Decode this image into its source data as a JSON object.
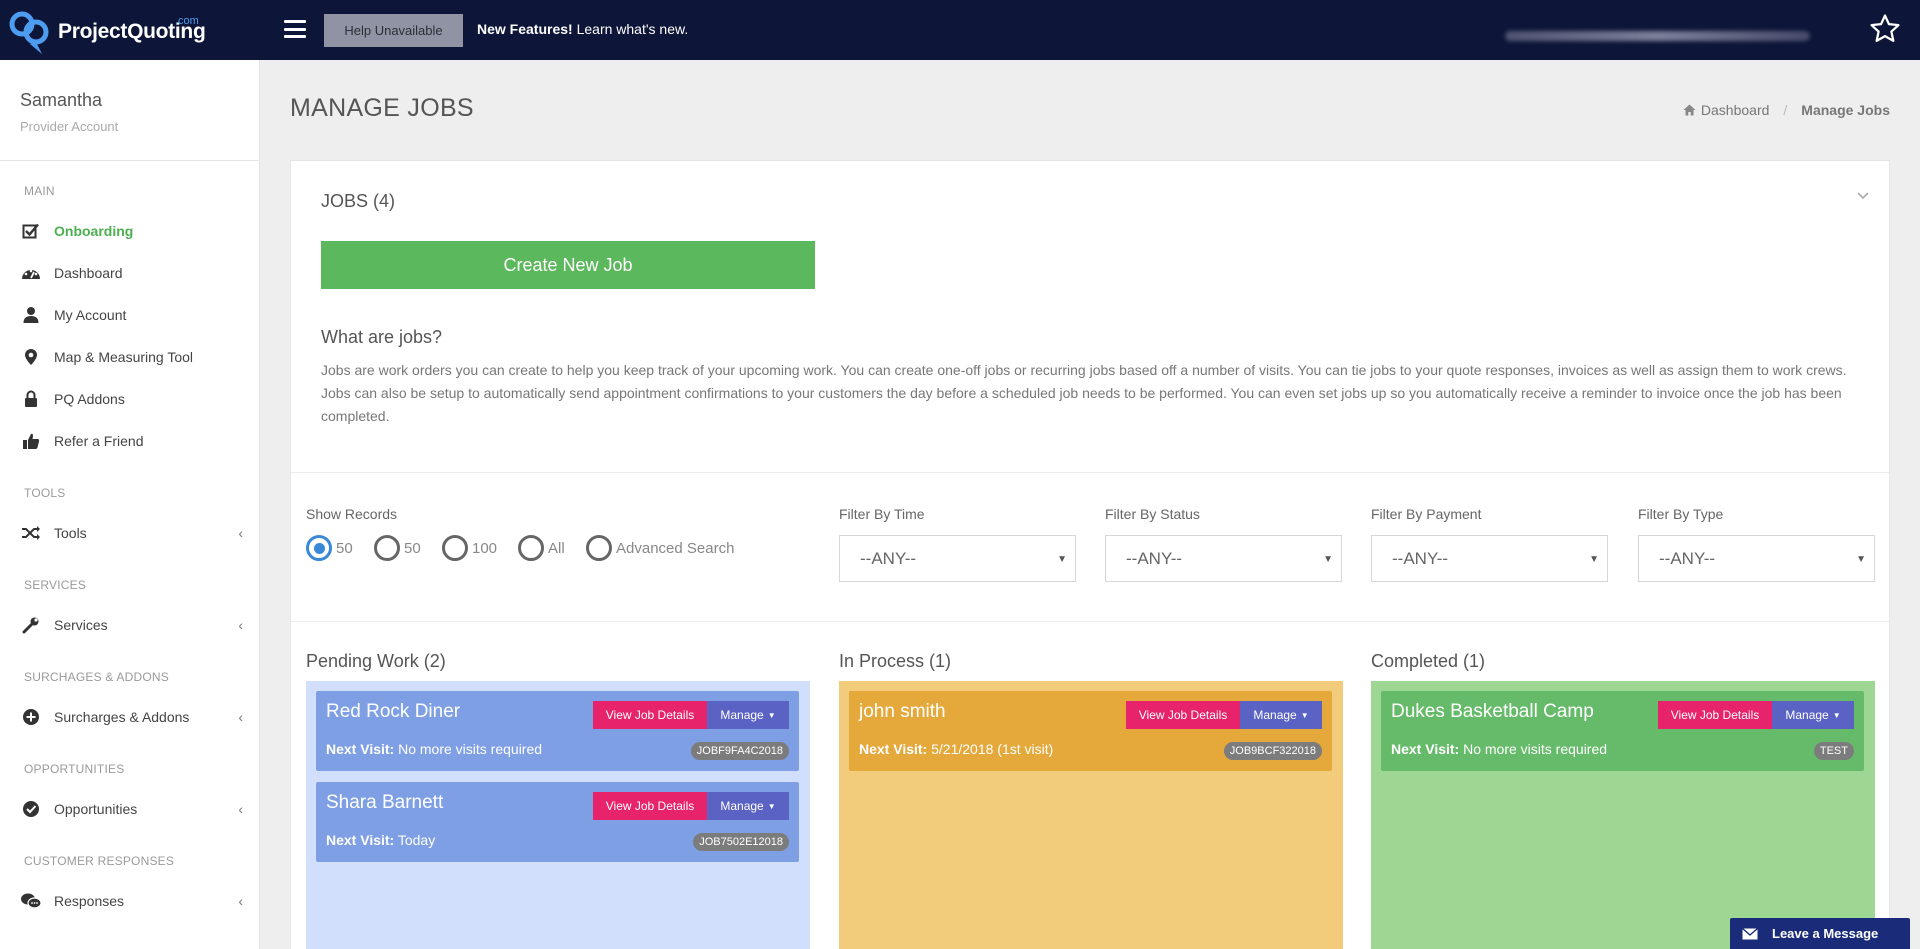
{
  "header": {
    "logo_text": "ProjectQuoting",
    "logo_suffix": ".com",
    "help_label": "Help Unavailable",
    "new_features_bold": "New Features!",
    "new_features_text": " Learn what's new."
  },
  "sidebar": {
    "user_name": "Samantha",
    "account_type": "Provider Account",
    "sections": {
      "main": "MAIN",
      "tools": "TOOLS",
      "services": "SERVICES",
      "surcharges": "SURCHAGES & ADDONS",
      "opportunities": "OPPORTUNITIES",
      "responses": "CUSTOMER RESPONSES"
    },
    "items": {
      "onboarding": "Onboarding",
      "dashboard": "Dashboard",
      "my_account": "My Account",
      "map_tool": "Map & Measuring Tool",
      "pq_addons": "PQ Addons",
      "refer": "Refer a Friend",
      "tools": "Tools",
      "services": "Services",
      "surcharges": "Surcharges & Addons",
      "opportunities": "Opportunities",
      "responses": "Responses"
    }
  },
  "page": {
    "title": "MANAGE JOBS",
    "breadcrumb_home": "Dashboard",
    "breadcrumb_current": "Manage Jobs"
  },
  "jobs_panel": {
    "title": "JOBS (4)",
    "create_label": "Create New Job",
    "what_title": "What are jobs?",
    "what_desc": "Jobs are work orders you can create to help you keep track of your upcoming work. You can create one-off jobs or recurring jobs based off a number of visits. You can tie jobs to your quote responses, invoices as well as assign them to work crews. Jobs can also be setup to automatically send appointment confirmations to your customers the day before a scheduled job needs to be performed. You can even set jobs up so you automatically receive a reminder to invoice once the job has been completed."
  },
  "filters": {
    "show_records_label": "Show Records",
    "radios": [
      "50",
      "50",
      "100",
      "All",
      "Advanced Search"
    ],
    "time_label": "Filter By Time",
    "status_label": "Filter By Status",
    "payment_label": "Filter By Payment",
    "type_label": "Filter By Type",
    "any": "--ANY--"
  },
  "columns": {
    "pending_title": "Pending Work (2)",
    "inprocess_title": "In Process (1)",
    "completed_title": "Completed (1)"
  },
  "job_buttons": {
    "view": "View Job Details",
    "manage": "Manage"
  },
  "jobs": [
    {
      "name": "Red Rock Diner",
      "next_label": "Next Visit:",
      "next_value": " No more visits required",
      "code": "JOBF9FA4C2018"
    },
    {
      "name": "Shara Barnett",
      "next_label": "Next Visit:",
      "next_value": " Today",
      "code": "JOB7502E12018"
    },
    {
      "name": "john smith",
      "next_label": "Next Visit:",
      "next_value": " 5/21/2018 (1st visit)",
      "code": "JOB9BCF322018"
    },
    {
      "name": "Dukes Basketball Camp",
      "next_label": "Next Visit:",
      "next_value": " No more visits required",
      "code": "TEST"
    }
  ],
  "chat": {
    "label": "Leave a Message"
  },
  "colors": {
    "topbar": "#0d1538",
    "accent_green": "#5cb85c",
    "view_btn": "#e6236b",
    "manage_btn": "#5a62c4",
    "pending": "#d1dffc",
    "inprocess": "#f3cc7b",
    "completed": "#9ed793"
  }
}
